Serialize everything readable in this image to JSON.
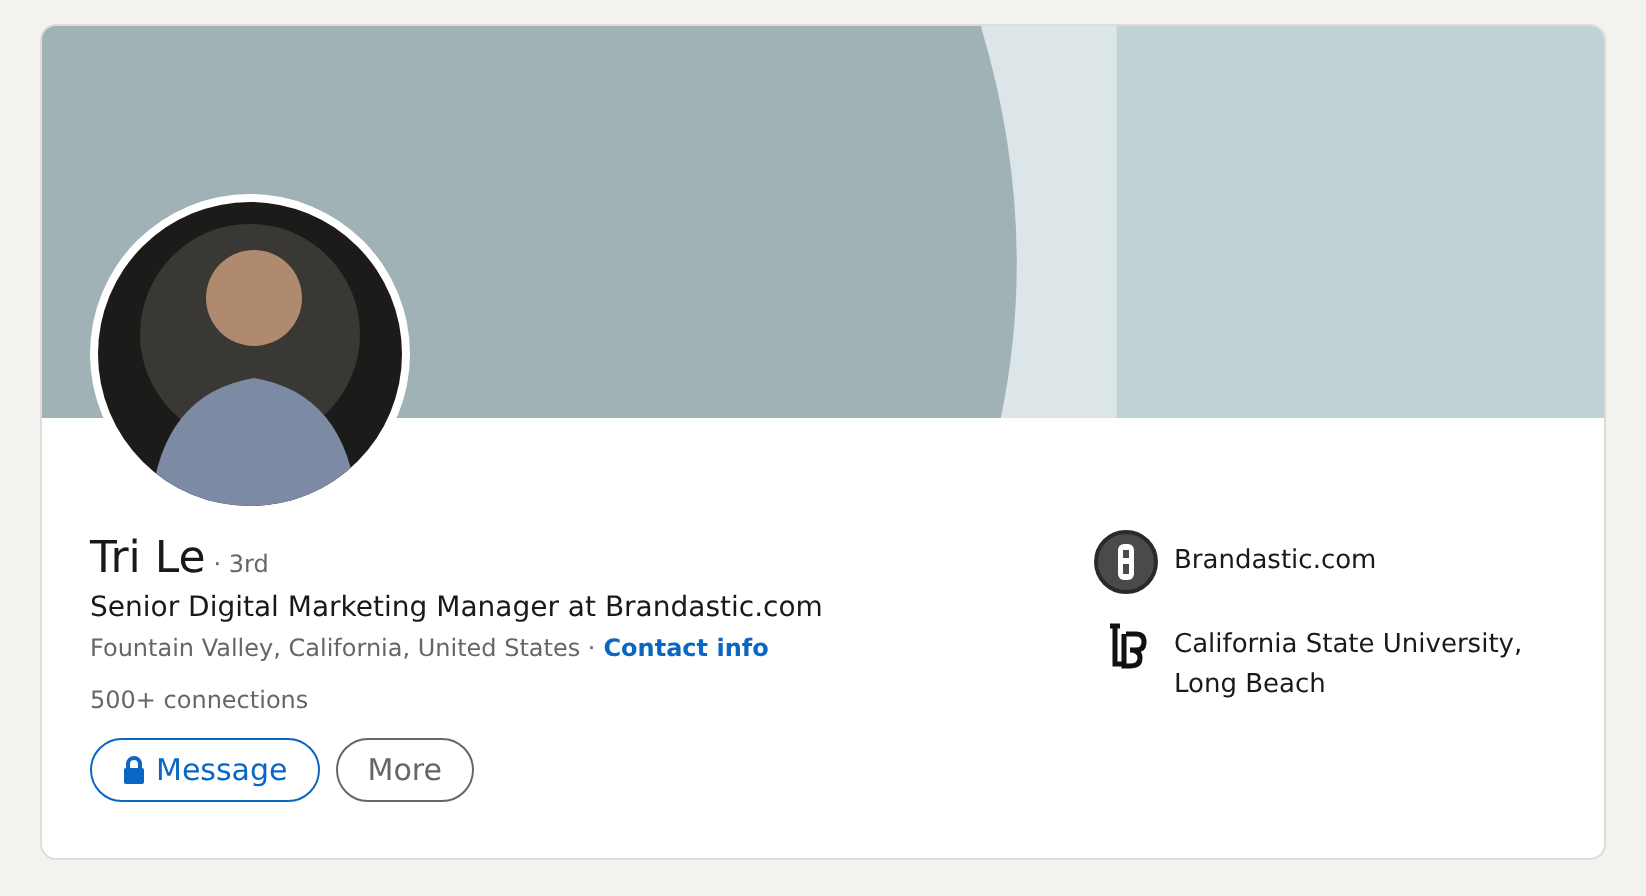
{
  "profile": {
    "name": "Tri Le",
    "degree": "· 3rd",
    "headline": "Senior Digital Marketing Manager at Brandastic.com",
    "location": "Fountain Valley, California, United States ·",
    "contact_link": "Contact info",
    "connections": "500+ connections"
  },
  "buttons": [
    {
      "label": "Message",
      "kind": "primary"
    },
    {
      "label": "More",
      "kind": "secondary"
    }
  ],
  "affiliations": [
    {
      "name": "Brandastic.com",
      "kind": "company"
    },
    {
      "name": "California State University, Long Beach",
      "kind": "school"
    }
  ]
}
